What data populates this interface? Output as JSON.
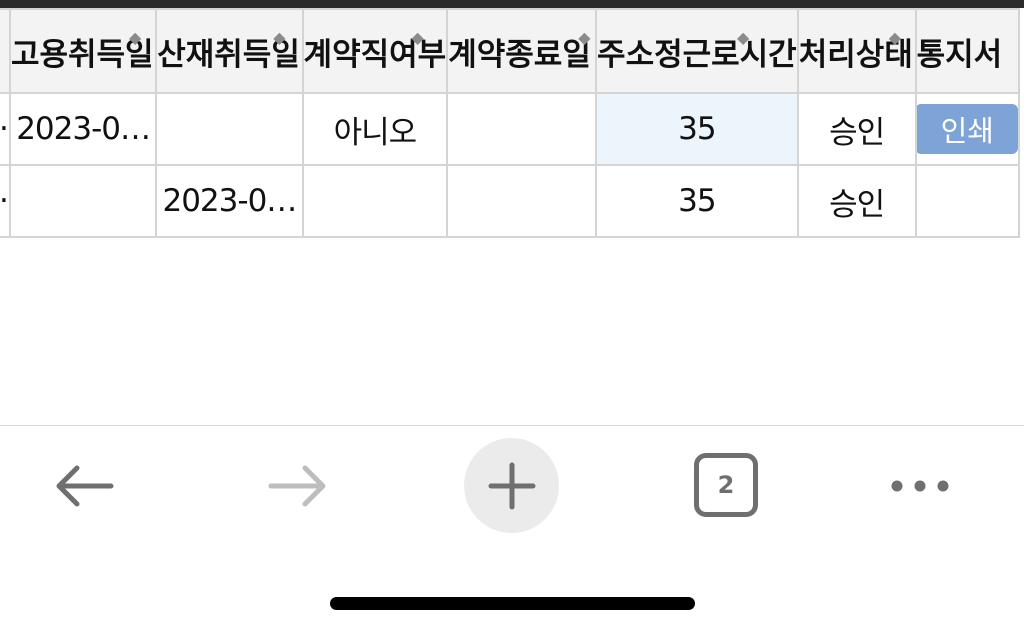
{
  "table": {
    "columns": [
      {
        "label": "고용취득일"
      },
      {
        "label": "산재취득일"
      },
      {
        "label": "계약직여부"
      },
      {
        "label": "계약종료일"
      },
      {
        "label": "주소정근로시간"
      },
      {
        "label": "처리상태"
      },
      {
        "label": "통지서"
      }
    ],
    "rows": [
      {
        "lead": "·",
        "employment_acq_date": "2023-0…",
        "industrial_acq_date": "",
        "contract_worker": "아니오",
        "contract_end": "",
        "weekly_hours": "35",
        "status": "승인",
        "notice_button": "인쇄"
      },
      {
        "lead": "·",
        "employment_acq_date": "",
        "industrial_acq_date": "2023-0…",
        "contract_worker": "",
        "contract_end": "",
        "weekly_hours": "35",
        "status": "승인",
        "notice_button": ""
      }
    ]
  },
  "toolbar": {
    "back_icon": "arrow-left-icon",
    "forward_icon": "arrow-right-icon",
    "new_tab_icon": "plus-icon",
    "tab_count": "2",
    "more_icon": "more-horizontal-icon"
  },
  "colors": {
    "header_bg": "#f3f3f3",
    "grid_border": "#d4d4d4",
    "highlight_cell": "#ecf4fc",
    "print_button": "#7ea3d6",
    "icon_active": "#6f6f6f",
    "icon_disabled": "#bdbdbd"
  }
}
